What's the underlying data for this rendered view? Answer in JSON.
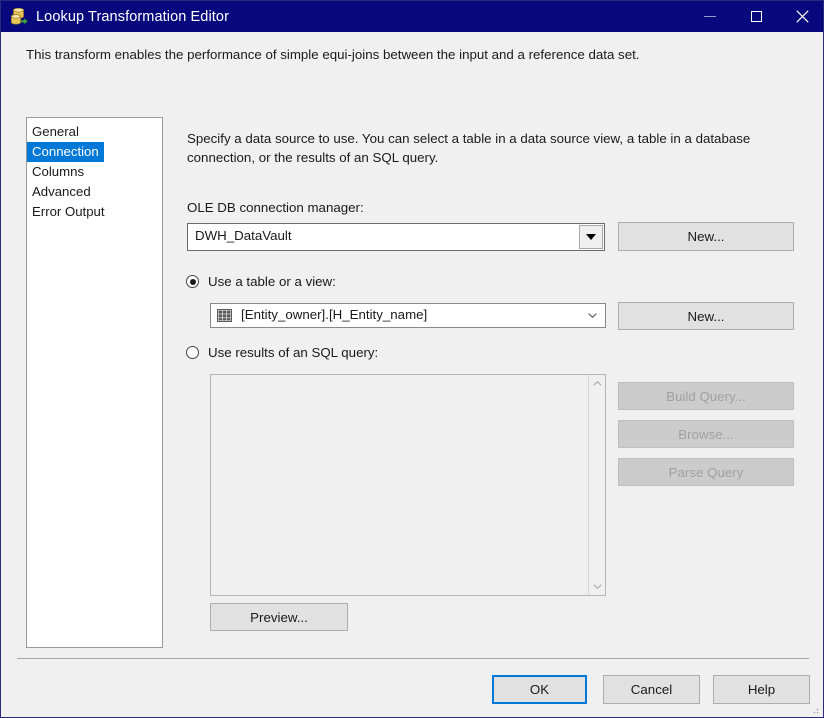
{
  "window": {
    "title": "Lookup Transformation Editor",
    "icon": "lookup-transformation-icon",
    "titlebar_color": "#09097e",
    "controls": {
      "minimize": "minimize-icon",
      "maximize": "maximize-icon",
      "close": "close-icon"
    }
  },
  "header": {
    "description": "This transform enables the performance of simple equi-joins between the input and a reference data set."
  },
  "nav": {
    "items": [
      {
        "label": "General",
        "selected": false
      },
      {
        "label": "Connection",
        "selected": true
      },
      {
        "label": "Columns",
        "selected": false
      },
      {
        "label": "Advanced",
        "selected": false
      },
      {
        "label": "Error Output",
        "selected": false
      }
    ],
    "selected_color": "#0078d7"
  },
  "panel": {
    "description": "Specify a data source to use. You can select a table in a data source view, a table in a database connection, or the results of an SQL query.",
    "connection_manager": {
      "label": "OLE DB connection manager:",
      "value": "DWH_DataVault",
      "new_button": "New..."
    },
    "table_option": {
      "radio_label": "Use a table or a view:",
      "selected": true,
      "value": "[Entity_owner].[H_Entity_name]",
      "icon": "table-grid-icon",
      "new_button": "New..."
    },
    "sql_option": {
      "radio_label": "Use results of an SQL query:",
      "selected": false,
      "query_text": "",
      "build_query_button": "Build Query...",
      "browse_button": "Browse...",
      "parse_query_button": "Parse Query",
      "preview_button": "Preview..."
    }
  },
  "footer": {
    "ok": "OK",
    "cancel": "Cancel",
    "help": "Help",
    "default_button": "OK",
    "focus_color": "#0078d7"
  }
}
